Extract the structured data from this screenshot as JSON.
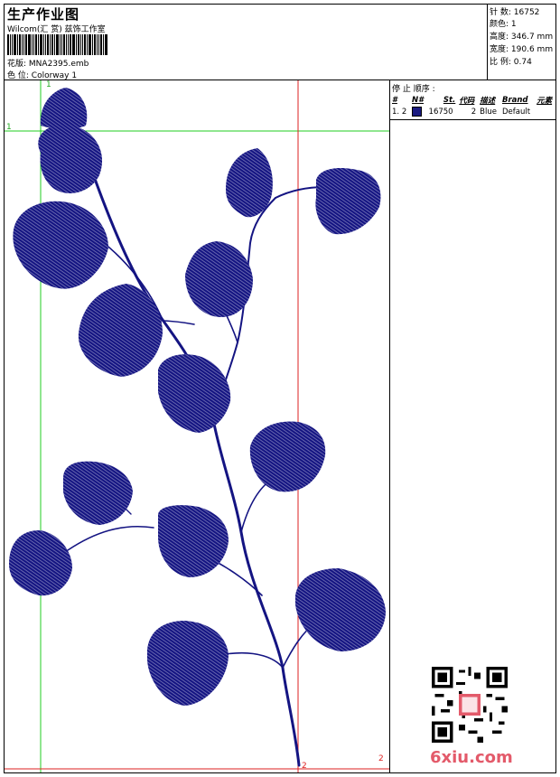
{
  "header": {
    "title": "生产作业图",
    "studio": "Wilcom(汇 赏) 兹饰工作室",
    "design_label": "花版:",
    "design_file": "MNA2395.emb",
    "colorway_label": "色 位:",
    "colorway_value": "Colorway 1"
  },
  "stats": [
    {
      "label": "针 数:",
      "value": "16752"
    },
    {
      "label": "颜色:",
      "value": "1"
    },
    {
      "label": "高度:",
      "value": "346.7 mm"
    },
    {
      "label": "宽度:",
      "value": "190.6 mm"
    },
    {
      "label": "比 例:",
      "value": "0.74"
    }
  ],
  "stop_sequence": {
    "title": "停 止 顺序 :",
    "columns": [
      "#",
      "N#",
      "St.",
      "代码",
      "描述",
      "Brand",
      "元素"
    ],
    "rows": [
      {
        "index": "1.",
        "needle": "2",
        "color": "#1a1a80",
        "stitches": "16750",
        "code": "2",
        "desc": "Blue",
        "brand": "Default",
        "element": ""
      }
    ]
  },
  "guides": {
    "green_v": "1",
    "green_h": "1",
    "red_v": "2",
    "red_h": "2"
  },
  "colors": {
    "thread": "#141482",
    "guide_green": "#22cc22",
    "guide_red": "#dd2222"
  },
  "watermark": "6xiu.com",
  "qr_stamp": "6xiu"
}
